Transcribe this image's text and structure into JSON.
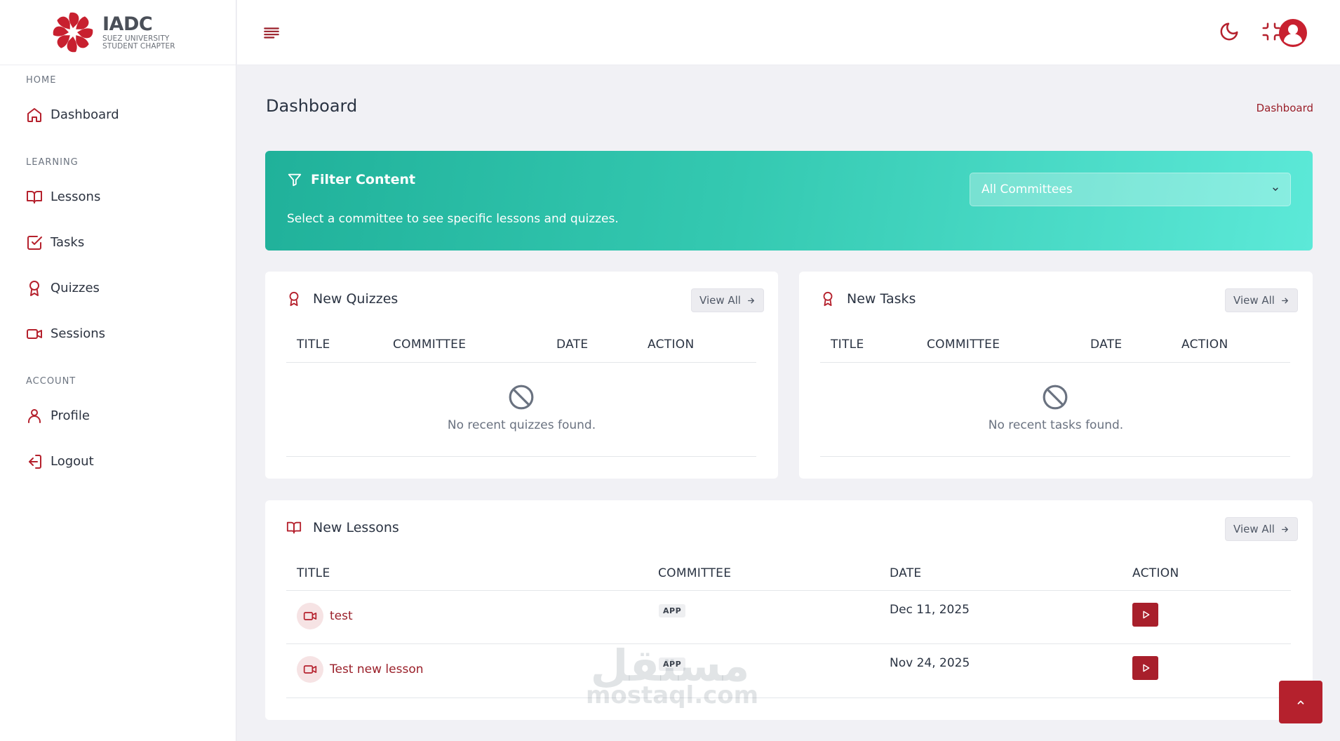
{
  "brand": {
    "title": "IADC",
    "subtitle_line1": "SUEZ UNIVERSITY",
    "subtitle_line2": "STUDENT CHAPTER"
  },
  "sidebar": {
    "sections": [
      {
        "label": "HOME",
        "items": [
          {
            "label": "Dashboard",
            "icon": "home-icon"
          }
        ]
      },
      {
        "label": "LEARNING",
        "items": [
          {
            "label": "Lessons",
            "icon": "book-open-icon"
          },
          {
            "label": "Tasks",
            "icon": "check-square-icon"
          },
          {
            "label": "Quizzes",
            "icon": "award-icon"
          },
          {
            "label": "Sessions",
            "icon": "video-icon"
          }
        ]
      },
      {
        "label": "ACCOUNT",
        "items": [
          {
            "label": "Profile",
            "icon": "user-icon"
          },
          {
            "label": "Logout",
            "icon": "logout-icon"
          }
        ]
      }
    ]
  },
  "page": {
    "title": "Dashboard",
    "breadcrumb": "Dashboard"
  },
  "filter": {
    "title": "Filter Content",
    "description": "Select a committee to see specific lessons and quizzes.",
    "selected": "All Committees"
  },
  "quizzes": {
    "title": "New Quizzes",
    "view_all": "View All",
    "columns": [
      "TITLE",
      "COMMITTEE",
      "DATE",
      "ACTION"
    ],
    "empty": "No recent quizzes found."
  },
  "tasks": {
    "title": "New Tasks",
    "view_all": "View All",
    "columns": [
      "TITLE",
      "COMMITTEE",
      "DATE",
      "ACTION"
    ],
    "empty": "No recent tasks found."
  },
  "lessons": {
    "title": "New Lessons",
    "view_all": "View All",
    "columns": [
      "TITLE",
      "COMMITTEE",
      "DATE",
      "ACTION"
    ],
    "rows": [
      {
        "title": "test",
        "committee": "APP",
        "date": "Dec 11, 2025"
      },
      {
        "title": "Test new lesson",
        "committee": "APP",
        "date": "Nov 24, 2025"
      }
    ]
  },
  "watermark": {
    "arabic": "مستقل",
    "latin": "mostaql.com"
  },
  "colors": {
    "accent": "#a81f2b",
    "filter_gradient_start": "#20b19a",
    "filter_gradient_end": "#5ce9d8",
    "background": "#f1f1f5"
  }
}
